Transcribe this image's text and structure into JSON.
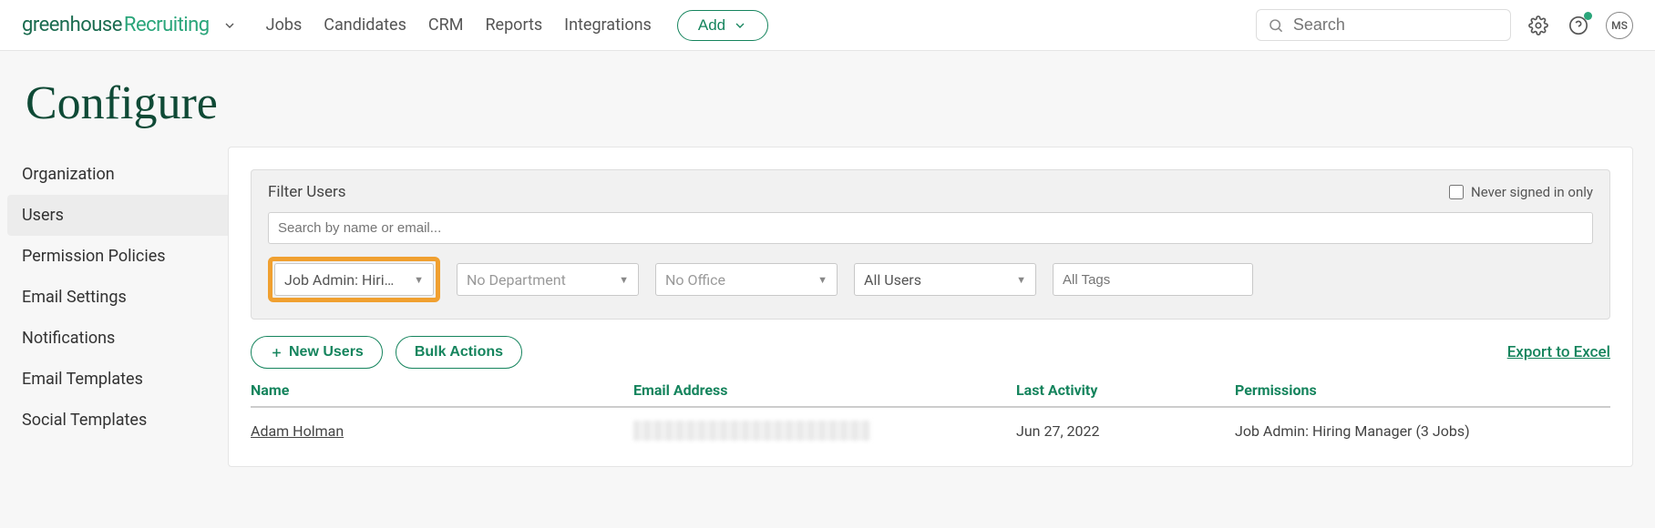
{
  "brand": {
    "part1": "greenhouse",
    "part2": "Recruiting"
  },
  "nav": {
    "jobs": "Jobs",
    "candidates": "Candidates",
    "crm": "CRM",
    "reports": "Reports",
    "integrations": "Integrations"
  },
  "add_label": "Add",
  "search": {
    "placeholder": "Search"
  },
  "avatar_initials": "MS",
  "page_title": "Configure",
  "sidebar": {
    "items": [
      {
        "label": "Organization",
        "active": false
      },
      {
        "label": "Users",
        "active": true
      },
      {
        "label": "Permission Policies",
        "active": false
      },
      {
        "label": "Email Settings",
        "active": false
      },
      {
        "label": "Notifications",
        "active": false
      },
      {
        "label": "Email Templates",
        "active": false
      },
      {
        "label": "Social Templates",
        "active": false
      }
    ]
  },
  "filters": {
    "title": "Filter Users",
    "never_signed_label": "Never signed in only",
    "search_placeholder": "Search by name or email...",
    "role_select": "Job Admin: Hiri…",
    "department_select": "No Department",
    "office_select": "No Office",
    "users_select": "All Users",
    "tags_placeholder": "All Tags"
  },
  "actions": {
    "new_users": "New Users",
    "bulk": "Bulk Actions",
    "export": "Export to Excel"
  },
  "table": {
    "headers": {
      "name": "Name",
      "email": "Email Address",
      "activity": "Last Activity",
      "permissions": "Permissions"
    },
    "rows": [
      {
        "name": "Adam Holman",
        "email": "",
        "activity": "Jun 27, 2022",
        "permissions": "Job Admin: Hiring Manager (3 Jobs)"
      }
    ]
  }
}
